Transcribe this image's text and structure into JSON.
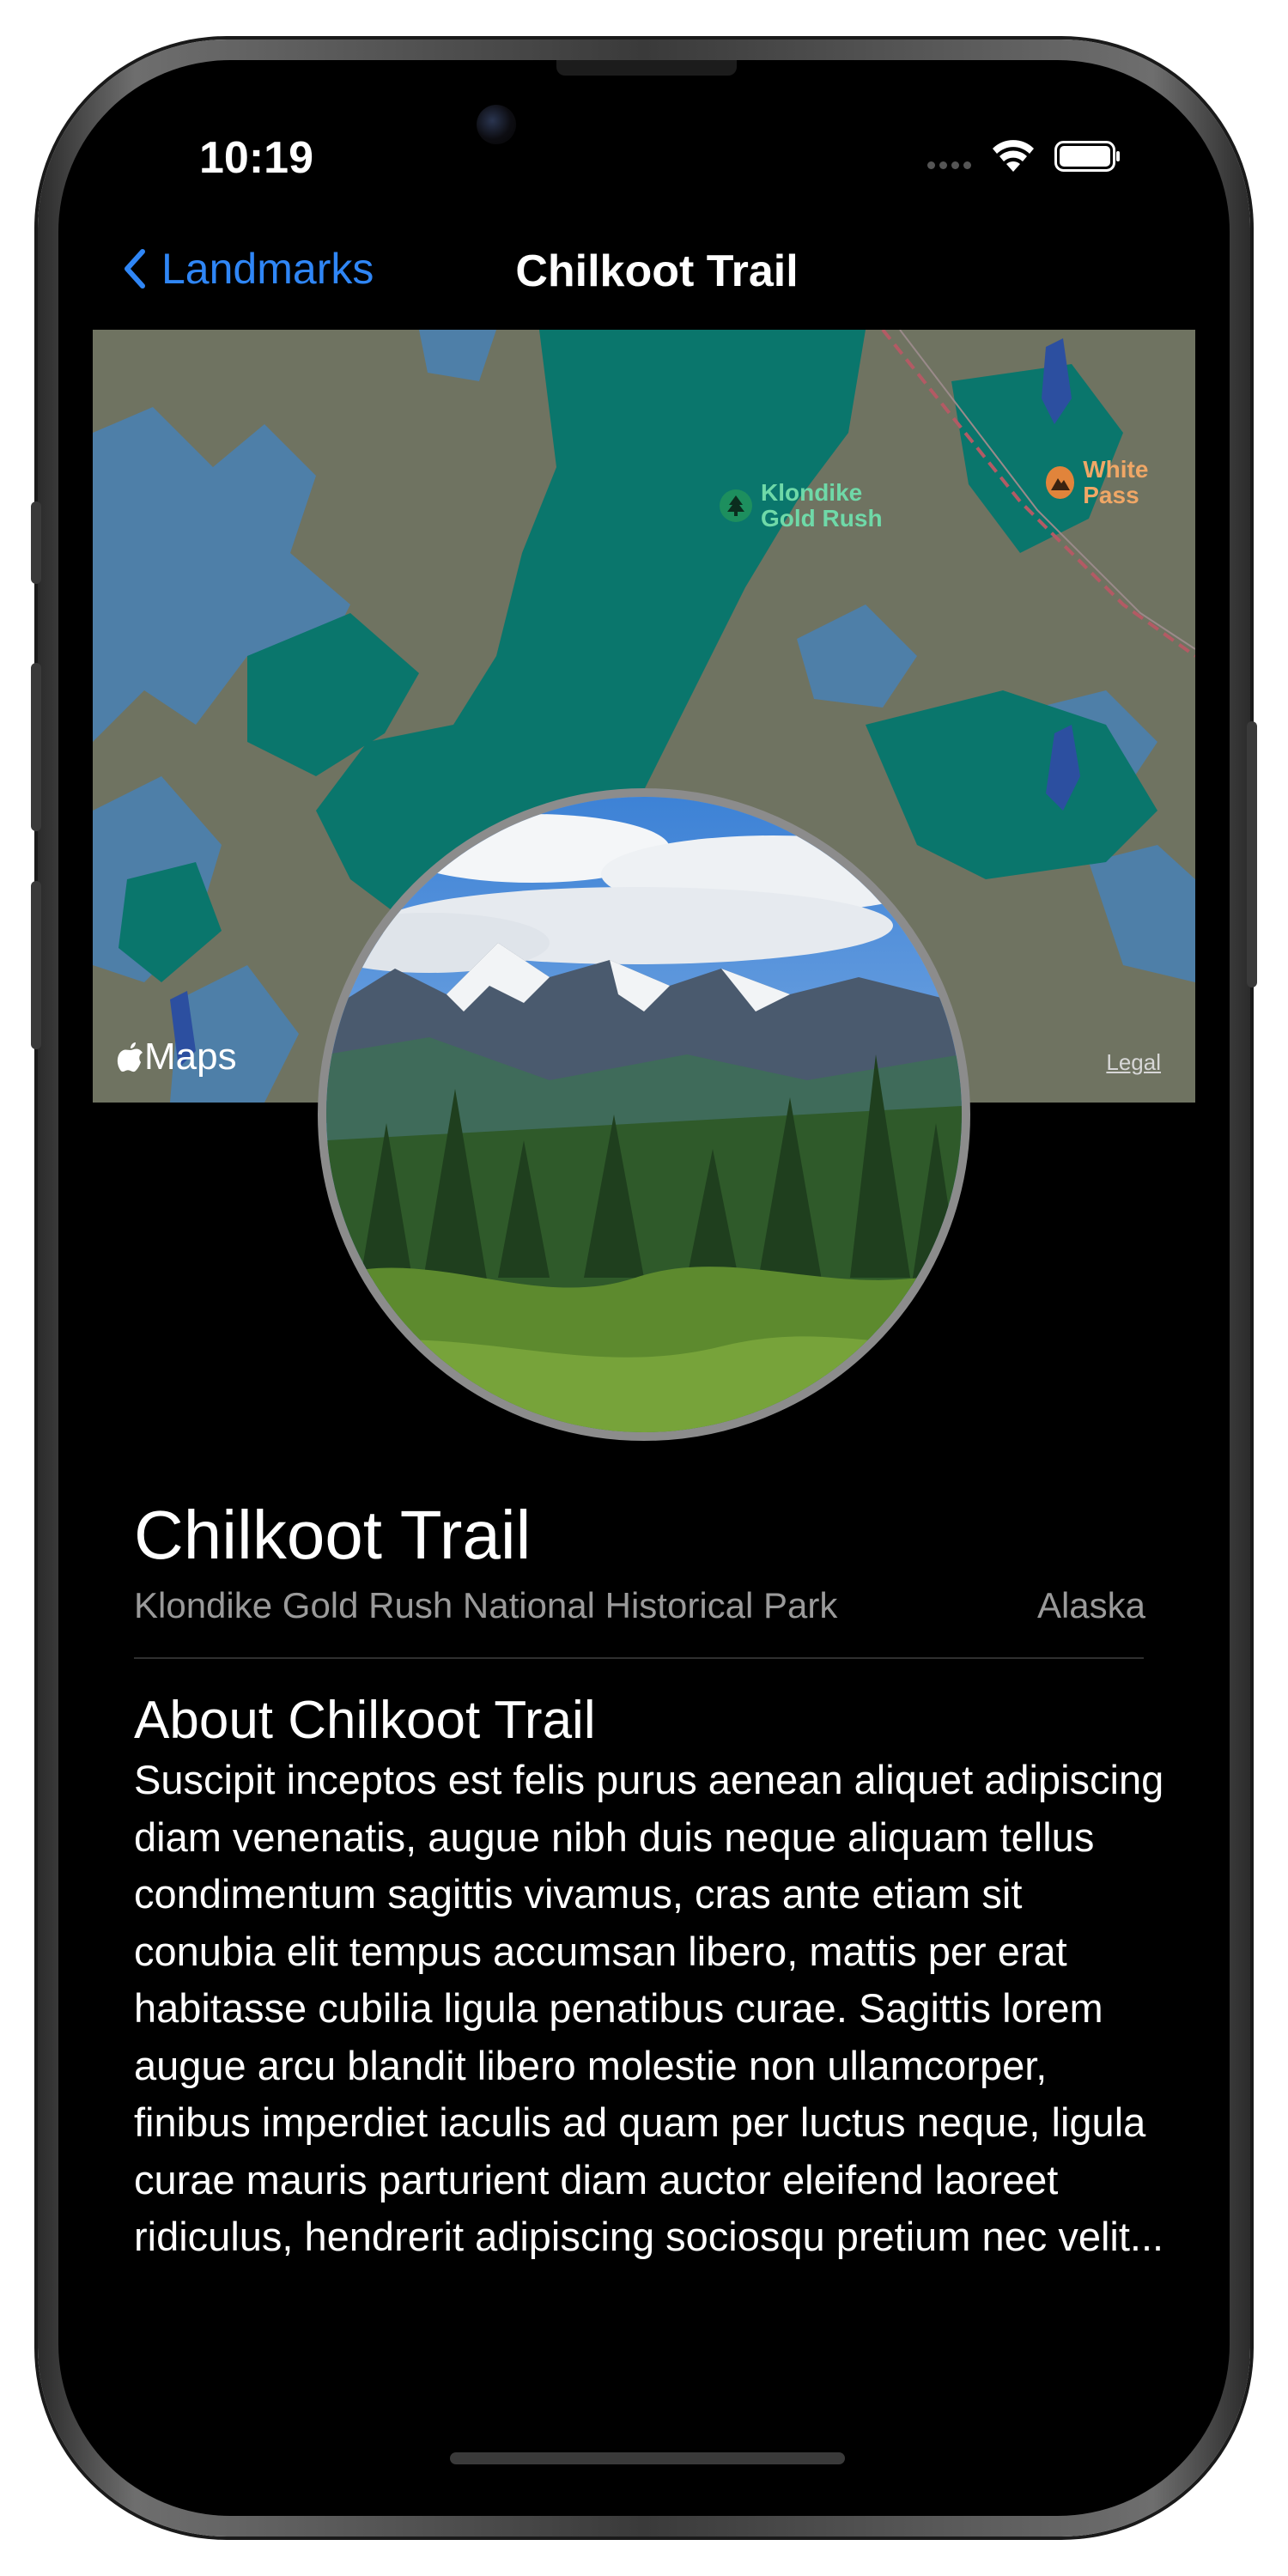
{
  "status_bar": {
    "time": "10:19"
  },
  "nav": {
    "back_label": "Landmarks",
    "title": "Chilkoot Trail"
  },
  "map": {
    "poi_klondike_line1": "Klondike",
    "poi_klondike_line2": "Gold Rush",
    "poi_whitepass": "White Pass",
    "maps_label": "Maps",
    "legal_label": "Legal"
  },
  "landmark": {
    "name": "Chilkoot Trail",
    "park": "Klondike Gold Rush National Historical Park",
    "state": "Alaska",
    "about_heading": "About Chilkoot Trail",
    "description": "Suscipit inceptos est felis purus aenean aliquet adipiscing diam venenatis, augue nibh duis neque aliquam tellus condimentum sagittis vivamus, cras ante etiam sit conubia elit tempus accumsan libero, mattis per erat habitasse cubilia ligula penatibus curae. Sagittis lorem augue arcu blandit libero molestie non ullamcorper, finibus imperdiet iaculis ad quam per luctus neque, ligula curae mauris parturient diam auctor eleifend laoreet ridiculus, hendrerit adipiscing sociosqu pretium nec velit..."
  },
  "colors": {
    "accent": "#2f86f6",
    "map_land": "#6f7361",
    "map_water": "#4e7fa8",
    "map_park": "#0a766c",
    "background": "#000000"
  }
}
